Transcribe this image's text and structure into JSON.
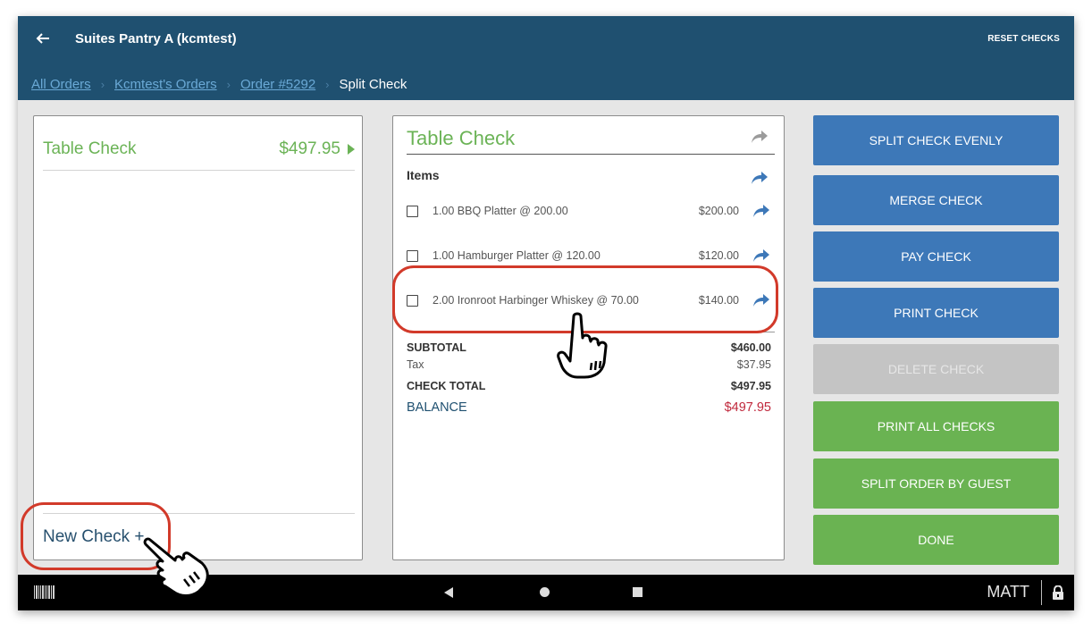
{
  "header": {
    "back_icon": "arrow-left-icon",
    "title": "Suites Pantry A (kcmtest)",
    "reset_label": "RESET CHECKS"
  },
  "breadcrumb": {
    "links": [
      "All Orders",
      "Kcmtest's Orders",
      "Order #5292"
    ],
    "current": "Split Check"
  },
  "checks_panel": {
    "checks": [
      {
        "name": "Table Check",
        "amount": "$497.95"
      }
    ],
    "new_check_label": "New Check +"
  },
  "check_detail": {
    "title": "Table Check",
    "items_header": "Items",
    "items": [
      {
        "description": "1.00 BBQ Platter @ 200.00",
        "price": "$200.00"
      },
      {
        "description": "1.00 Hamburger Platter @ 120.00",
        "price": "$120.00"
      },
      {
        "description": "2.00 Ironroot Harbinger Whiskey @ 70.00",
        "price": "$140.00"
      }
    ],
    "totals": {
      "subtotal_label": "SUBTOTAL",
      "subtotal": "$460.00",
      "tax_label": "Tax",
      "tax": "$37.95",
      "check_total_label": "CHECK TOTAL",
      "check_total": "$497.95",
      "balance_label": "BALANCE",
      "balance": "$497.95"
    }
  },
  "actions": [
    {
      "label": "SPLIT CHECK EVENLY",
      "style": "blue",
      "enabled": true
    },
    {
      "label": "MERGE CHECK",
      "style": "blue",
      "enabled": true
    },
    {
      "label": "PAY CHECK",
      "style": "blue",
      "enabled": true
    },
    {
      "label": "PRINT CHECK",
      "style": "blue",
      "enabled": true
    },
    {
      "label": "DELETE CHECK",
      "style": "gray",
      "enabled": false
    },
    {
      "label": "PRINT ALL CHECKS",
      "style": "green",
      "enabled": true
    },
    {
      "label": "SPLIT ORDER BY GUEST",
      "style": "green",
      "enabled": true
    },
    {
      "label": "DONE",
      "style": "green",
      "enabled": true
    }
  ],
  "navbar": {
    "user": "MATT",
    "icons": [
      "barcode-icon",
      "nav-back-icon",
      "nav-home-icon",
      "nav-recent-icon",
      "lock-icon"
    ]
  },
  "colors": {
    "header": "#1f5070",
    "accent_green": "#6bb356",
    "button_blue": "#3d78b8",
    "button_green": "#6ab352",
    "button_disabled": "#c4c4c4",
    "balance_red": "#c0283c",
    "callout_red": "#d23a2a"
  }
}
